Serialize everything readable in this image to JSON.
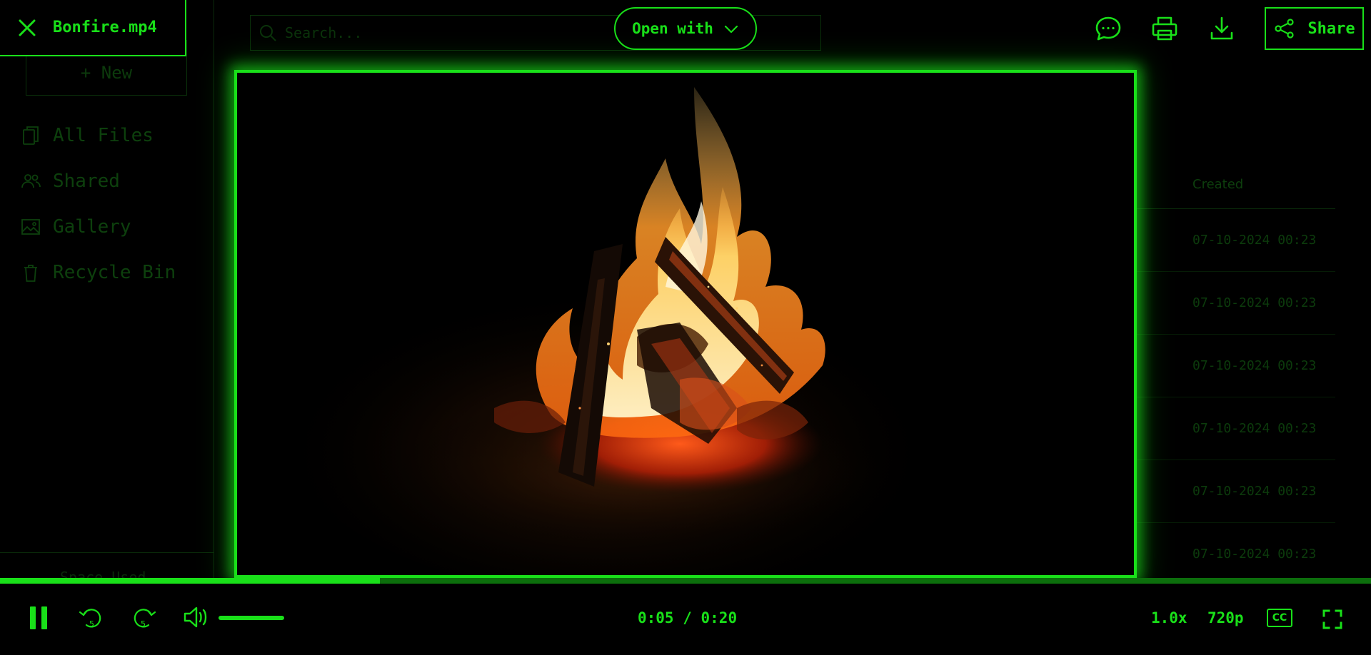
{
  "file": {
    "name": "Bonfire.mp4"
  },
  "sidebar": {
    "new_label": "+ New",
    "items": [
      {
        "label": "All Files",
        "icon": "files-icon"
      },
      {
        "label": "Shared",
        "icon": "people-icon"
      },
      {
        "label": "Gallery",
        "icon": "image-icon"
      },
      {
        "label": "Recycle Bin",
        "icon": "trash-icon"
      }
    ],
    "footer_partial": "Space Used"
  },
  "search": {
    "placeholder": "Search..."
  },
  "header": {
    "open_with_label": "Open with",
    "share_label": "Share",
    "icons": [
      "comment-icon",
      "print-icon",
      "download-icon",
      "share-icon"
    ]
  },
  "file_table": {
    "column_created": "Created",
    "rows": [
      "07-10-2024 00:23",
      "07-10-2024 00:23",
      "07-10-2024 00:23",
      "07-10-2024 00:23",
      "07-10-2024 00:23",
      "07-10-2024 00:23"
    ]
  },
  "player": {
    "current_time": "0:05",
    "duration": "0:20",
    "time_separator": " / ",
    "progress_fraction": 0.277,
    "rewind_seconds": "5",
    "forward_seconds": "5",
    "volume_fraction": 1.0,
    "speed": "1.0x",
    "quality": "720p",
    "captions_label": "CC",
    "state": "playing"
  },
  "theme": {
    "accent": "#19e019",
    "background": "#000000"
  }
}
